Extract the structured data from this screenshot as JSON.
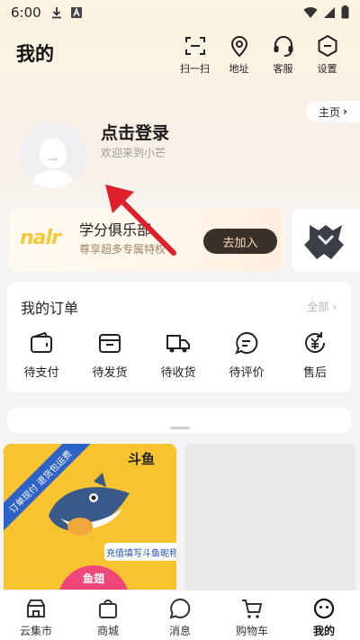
{
  "status_bar": {
    "time": "6:00"
  },
  "header": {
    "title": "我的",
    "actions": [
      {
        "label": "扫一扫",
        "icon": "scan-icon"
      },
      {
        "label": "地址",
        "icon": "location-icon"
      },
      {
        "label": "客服",
        "icon": "headset-icon"
      },
      {
        "label": "设置",
        "icon": "settings-icon"
      }
    ],
    "home_link": "主页"
  },
  "profile": {
    "login_title": "点击登录",
    "welcome": "欢迎来到小芒"
  },
  "club": {
    "logo_text": "nalr",
    "title": "学分俱乐部",
    "subtitle": "尊享超多专属特权",
    "join_label": "去加入"
  },
  "orders": {
    "title": "我的订单",
    "all_label": "全部",
    "items": [
      {
        "label": "待支付",
        "icon": "wallet-icon"
      },
      {
        "label": "待发货",
        "icon": "package-icon"
      },
      {
        "label": "待收货",
        "icon": "truck-icon"
      },
      {
        "label": "待评价",
        "icon": "comment-icon"
      },
      {
        "label": "售后",
        "icon": "refund-icon"
      }
    ]
  },
  "feed": {
    "card1": {
      "ribbon": "订单现付 退货包运费",
      "brand": "斗鱼",
      "tag": "充值填写斗鱼昵称",
      "price": "鱼翅"
    }
  },
  "tabs": [
    {
      "label": "云集市",
      "icon": "market-icon",
      "active": false
    },
    {
      "label": "商城",
      "icon": "shop-bag-icon",
      "active": false
    },
    {
      "label": "消息",
      "icon": "message-icon",
      "active": false
    },
    {
      "label": "购物车",
      "icon": "cart-icon",
      "active": false
    },
    {
      "label": "我的",
      "icon": "profile-face-icon",
      "active": true
    }
  ],
  "colors": {
    "accent_dark": "#3a302a",
    "join_text": "#f5ddb6",
    "arrow_red": "#e0202a",
    "feed_yellow": "#f7c430"
  }
}
